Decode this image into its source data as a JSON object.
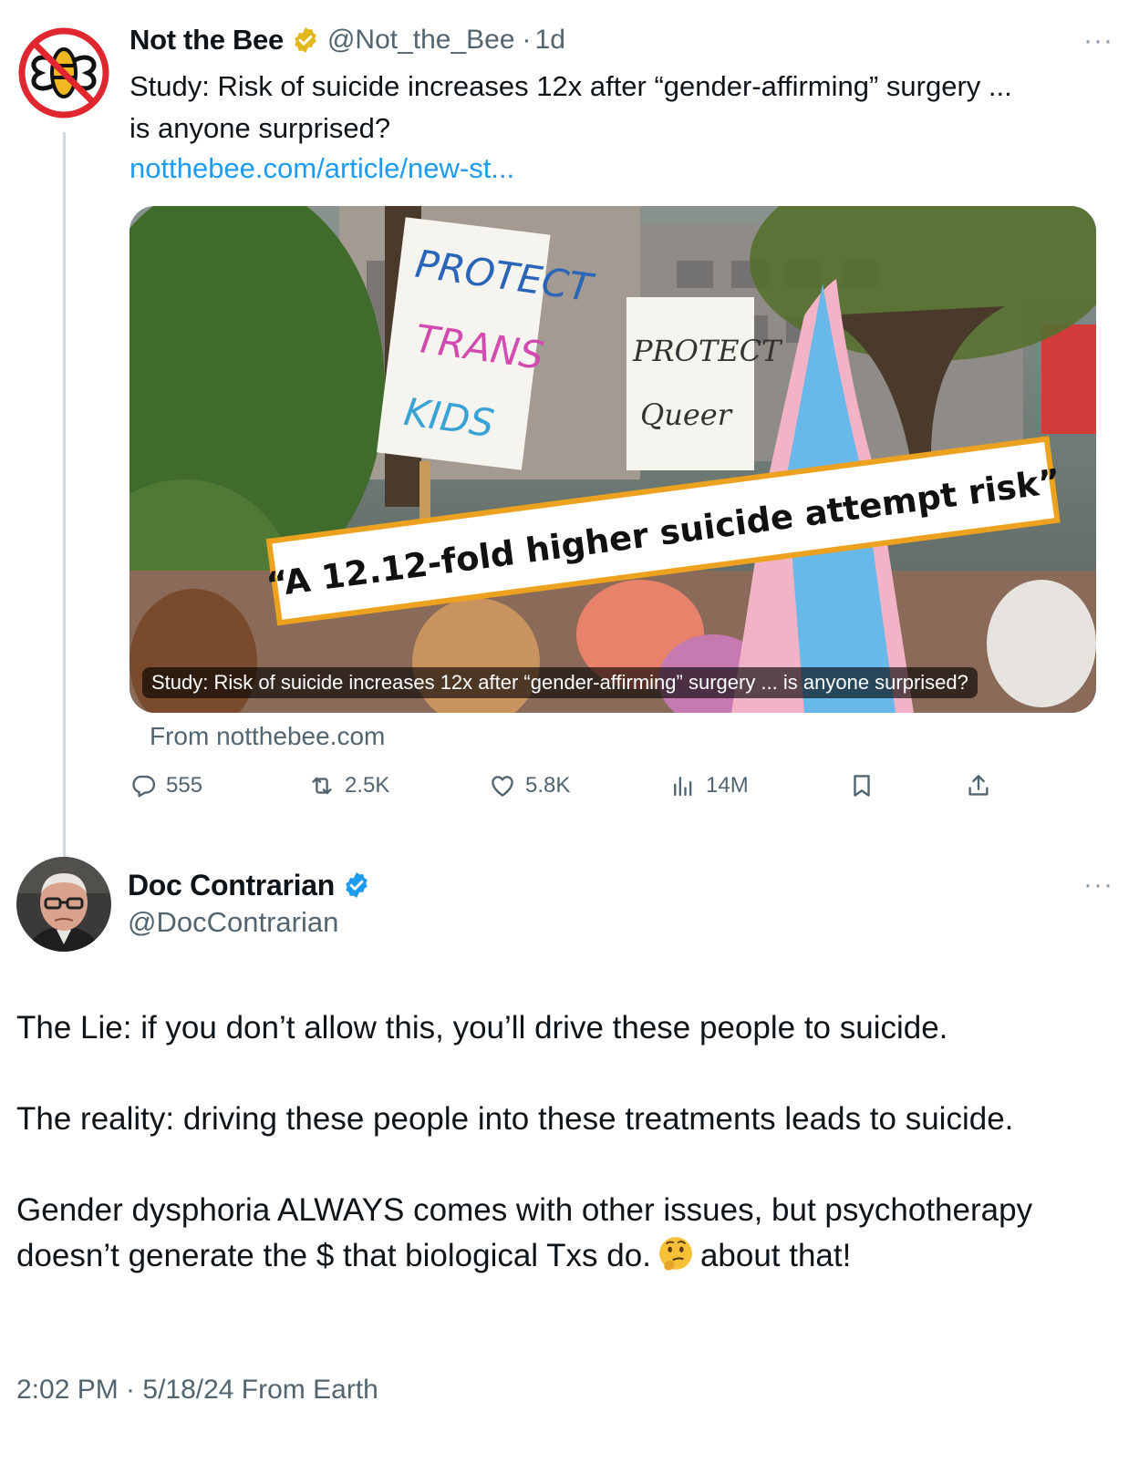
{
  "parent": {
    "author_name": "Not the Bee",
    "handle": "@Not_the_Bee",
    "separator": "·",
    "time": "1d",
    "text_line1": "Study: Risk of suicide increases 12x after “gender-affirming” surgery ...",
    "text_line2": "is anyone surprised?",
    "link": "notthebee.com/article/new-st...",
    "card": {
      "sign_left": [
        "PROTECT",
        "TRANS",
        "KIDS"
      ],
      "sign_right": [
        "PROTECT",
        "Queer"
      ],
      "banner": "“A 12.12-fold higher suicide attempt risk”",
      "caption": "Study: Risk of suicide increases 12x after “gender-affirming” surgery ... is anyone surprised?",
      "from": "From notthebee.com"
    },
    "actions": {
      "replies": "555",
      "reposts": "2.5K",
      "likes": "5.8K",
      "views": "14M"
    }
  },
  "main": {
    "author_name": "Doc Contrarian",
    "handle": "@DocContrarian",
    "para1": "The Lie: if you don’t allow this, you’ll drive these people to suicide.",
    "para2": "The reality: driving these people into these treatments leads to suicide.",
    "para3_a": "Gender dysphoria ALWAYS comes with other issues, but psychotherapy doesn’t generate the $ that biological Txs do.",
    "para3_b": "about that!",
    "emoji": "thinking-face",
    "timestamp": "2:02 PM · 5/18/24 From Earth"
  },
  "colors": {
    "link": "#1d9bf0",
    "verified_blue": "#1d9bf0",
    "verified_gold": "#e2b719",
    "secondary_text": "#536471",
    "thread_line": "#cfd9de"
  },
  "more_label": "···"
}
